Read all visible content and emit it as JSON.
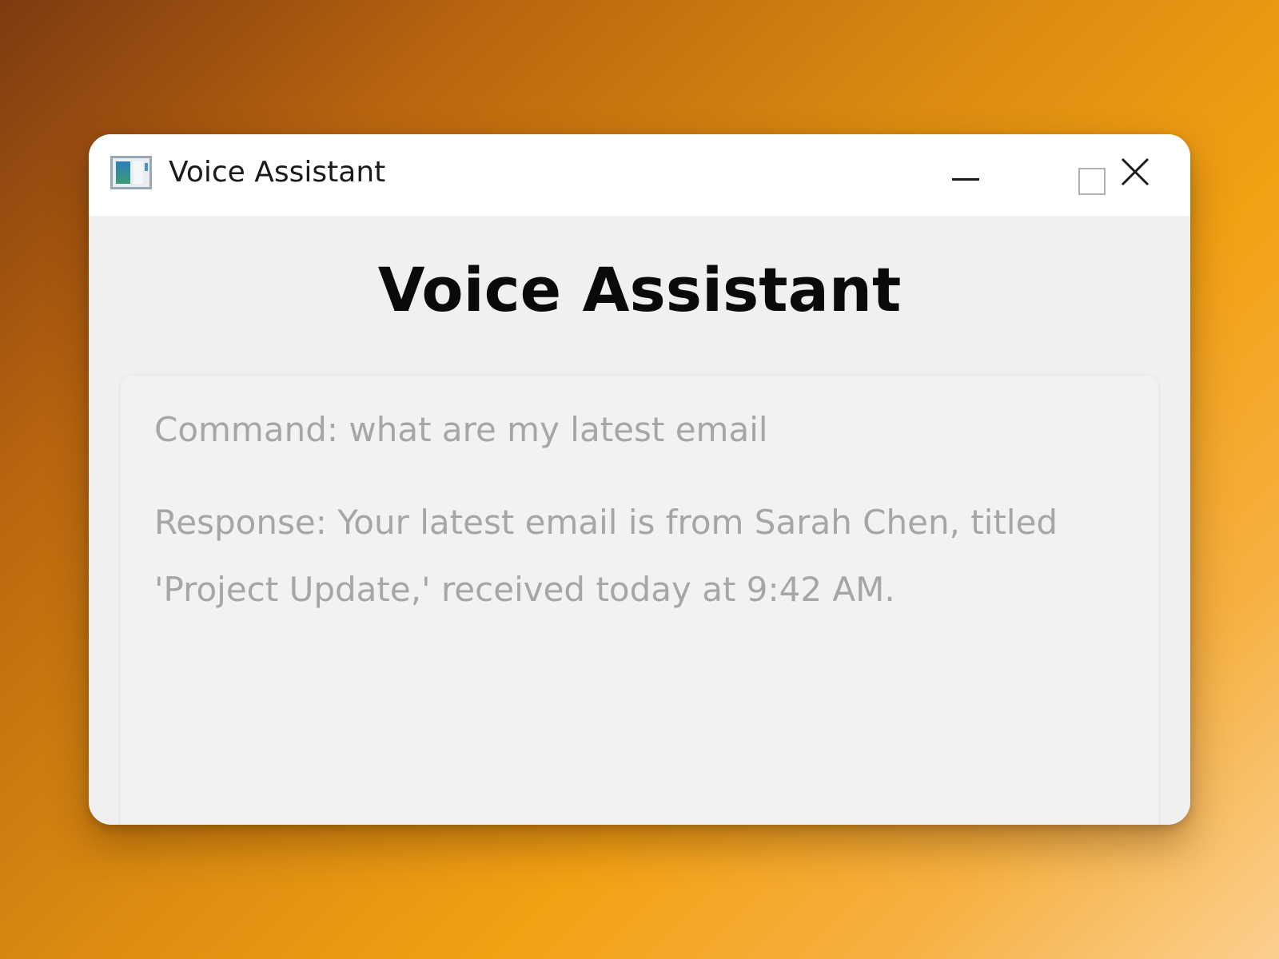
{
  "window": {
    "title": "Voice Assistant"
  },
  "main": {
    "heading": "Voice Assistant",
    "command_text": "Command: what are my latest email",
    "response_text": "Response: Your latest email is from Sarah Chen, titled 'Project Update,' received today at 9:42 AM."
  },
  "icons": {
    "app": "app-window-icon",
    "minimize": "minimize-icon",
    "maximize": "maximize-icon",
    "close": "close-icon"
  },
  "colors": {
    "titlebar": "#ffffff",
    "window_body": "#f0f0f0",
    "heading_text": "#0a0a0a",
    "log_text": "#a6a6a6"
  }
}
